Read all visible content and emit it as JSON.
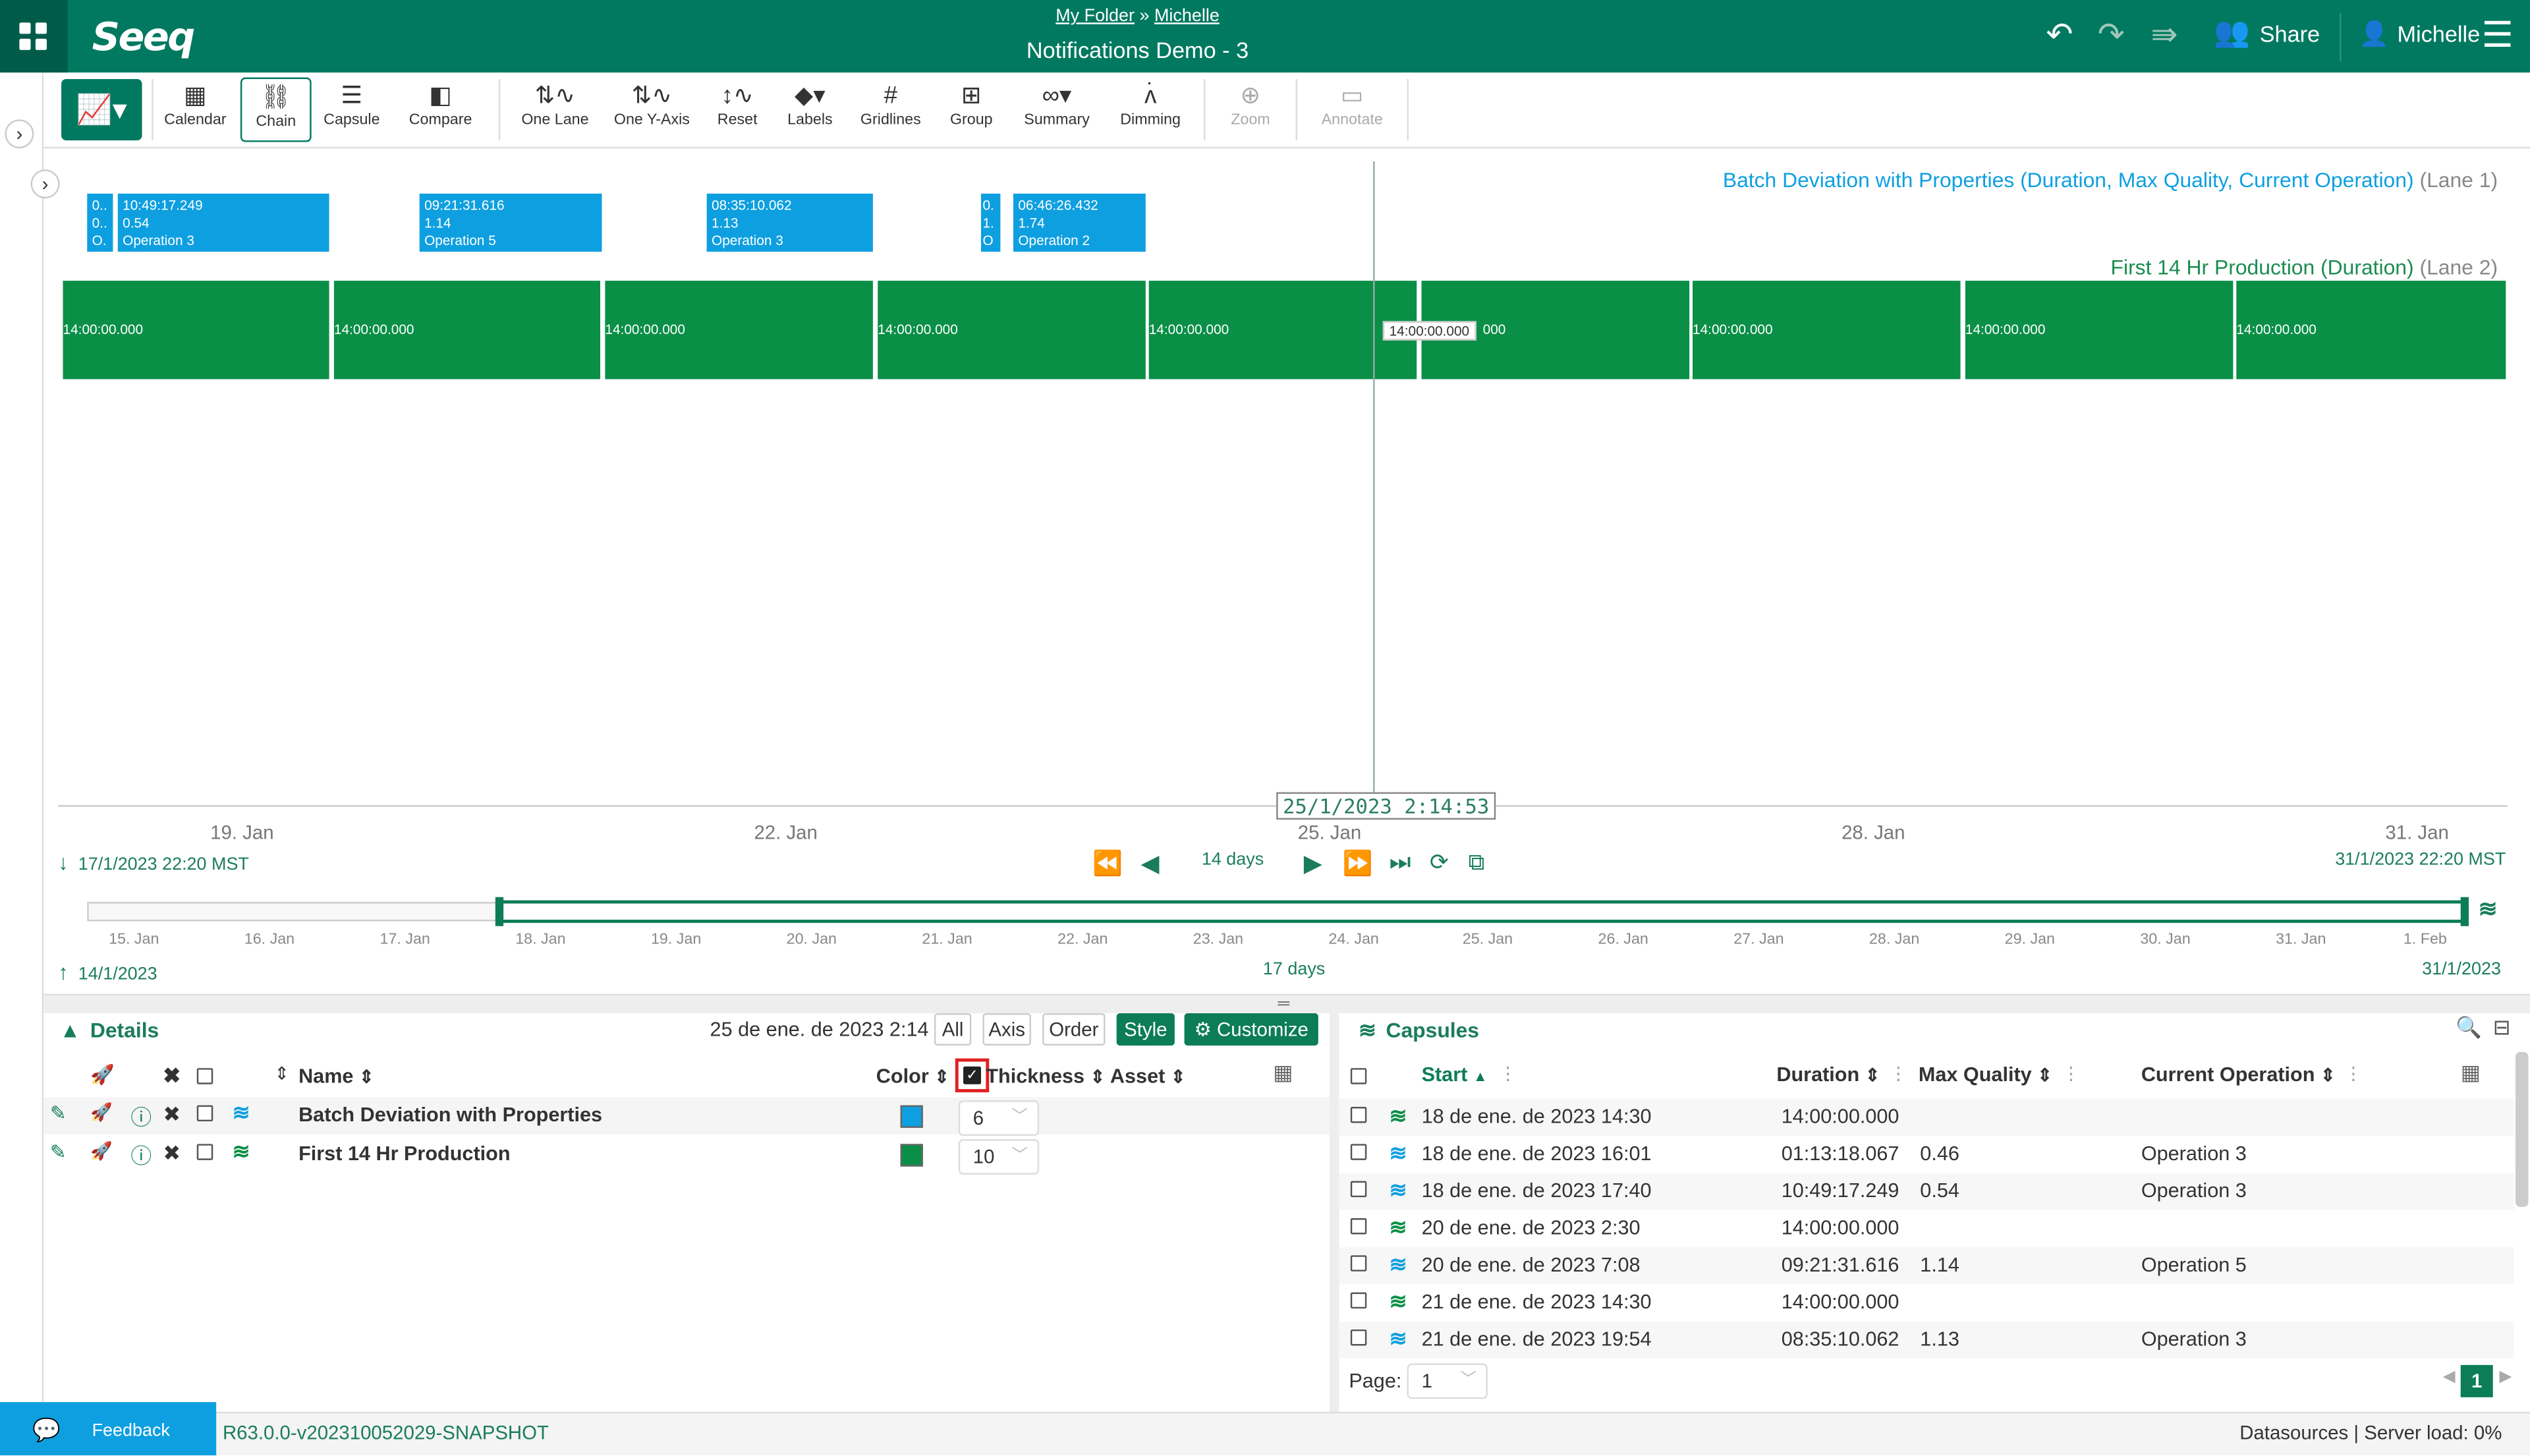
{
  "header": {
    "breadcrumb_folder": "My Folder",
    "breadcrumb_sep": "»",
    "breadcrumb_user": "Michelle",
    "title": "Notifications Demo - 3",
    "share_label": "Share",
    "user_label": "Michelle",
    "logo": "Seeq"
  },
  "toolbar": {
    "items": [
      {
        "label": "Calendar",
        "icon": "calendar-icon",
        "glyph": "▦"
      },
      {
        "label": "Chain",
        "icon": "chain-icon",
        "glyph": "⛓"
      },
      {
        "label": "Capsule",
        "icon": "capsule-icon",
        "glyph": "☰"
      },
      {
        "label": "Compare",
        "icon": "compare-icon",
        "glyph": "◧"
      },
      {
        "label": "One Lane",
        "icon": "one-lane-icon",
        "glyph": "⇅"
      },
      {
        "label": "One Y-Axis",
        "icon": "one-y-axis-icon",
        "glyph": "⇅"
      },
      {
        "label": "Reset",
        "icon": "reset-icon",
        "glyph": "↕"
      },
      {
        "label": "Labels",
        "icon": "labels-icon",
        "glyph": "🏷"
      },
      {
        "label": "Gridlines",
        "icon": "gridlines-icon",
        "glyph": "#"
      },
      {
        "label": "Group",
        "icon": "group-icon",
        "glyph": "⊞"
      },
      {
        "label": "Summary",
        "icon": "summary-icon",
        "glyph": "∿"
      },
      {
        "label": "Dimming",
        "icon": "dimming-icon",
        "glyph": "ʌ"
      },
      {
        "label": "Zoom",
        "icon": "zoom-icon",
        "glyph": "⊕"
      },
      {
        "label": "Annotate",
        "icon": "annotate-icon",
        "glyph": "💬"
      }
    ]
  },
  "chart": {
    "lane1_title": "Batch Deviation with Properties (Duration, Max Quality, ",
    "lane1_title_b": "Current Operation)",
    "lane1_suffix": "(Lane 1)",
    "lane2_title": "First 14 Hr Production (Duration)",
    "lane2_suffix": "(Lane 2)",
    "blue_capsules": [
      {
        "l1": "0..",
        "l2": "0..",
        "l3": "O."
      },
      {
        "l1": "10:49:17.249",
        "l2": "0.54",
        "l3": "Operation 3"
      },
      {
        "l1": "09:21:31.616",
        "l2": "1.14",
        "l3": "Operation 5"
      },
      {
        "l1": "08:35:10.062",
        "l2": "1.13",
        "l3": "Operation 3"
      },
      {
        "l1": "0.",
        "l2": "1.",
        "l3": "O"
      },
      {
        "l1": "06:46:26.432",
        "l2": "1.74",
        "l3": "Operation 2"
      }
    ],
    "green_capsules": [
      "14:00:00.000",
      "14:00:00.000",
      "14:00:00.000",
      "14:00:00.000",
      "14:00:00.000",
      "000",
      "14:00:00.000",
      "14:00:00.000",
      "14:00:00.000"
    ],
    "cursor_label": "14:00:00.000",
    "cursor_time": "25/1/2023 2:14:53",
    "x_ticks": [
      "19. Jan",
      "22. Jan",
      "25. Jan",
      "28. Jan",
      "31. Jan"
    ],
    "display_start": "17/1/2023 22:20  MST",
    "display_end": "31/1/2023 22:20  MST",
    "duration": "14 days",
    "nav_ticks": [
      "15. Jan",
      "16. Jan",
      "17. Jan",
      "18. Jan",
      "19. Jan",
      "20. Jan",
      "21. Jan",
      "22. Jan",
      "23. Jan",
      "24. Jan",
      "25. Jan",
      "26. Jan",
      "27. Jan",
      "28. Jan",
      "29. Jan",
      "30. Jan",
      "31. Jan",
      "1. Feb"
    ],
    "investigate_start": "14/1/2023",
    "investigate_end": "31/1/2023",
    "investigate_duration": "17 days"
  },
  "details": {
    "title": "Details",
    "timestamp": "25 de ene. de 2023 2:14",
    "buttons": {
      "all": "All",
      "axis": "Axis",
      "order": "Order",
      "style": "Style",
      "customize": "Customize"
    },
    "columns": {
      "name": "Name",
      "color": "Color",
      "thickness": "Thickness",
      "asset": "Asset"
    },
    "rows": [
      {
        "name": "Batch Deviation with Properties",
        "color": "#0e9fe0",
        "thickness": "6"
      },
      {
        "name": "First 14 Hr Production",
        "color": "#0a8f47",
        "thickness": "10"
      }
    ]
  },
  "capsules": {
    "title": "Capsules",
    "columns": {
      "start": "Start",
      "duration": "Duration",
      "max_quality": "Max Quality",
      "current_operation": "Current Operation"
    },
    "rows": [
      {
        "start": "18 de ene. de 2023 14:30",
        "duration": "14:00:00.000",
        "mq": "",
        "op": "",
        "color": "#0a8f47"
      },
      {
        "start": "18 de ene. de 2023 16:01",
        "duration": "01:13:18.067",
        "mq": "0.46",
        "op": "Operation 3",
        "color": "#0e9fe0"
      },
      {
        "start": "18 de ene. de 2023 17:40",
        "duration": "10:49:17.249",
        "mq": "0.54",
        "op": "Operation 3",
        "color": "#0e9fe0"
      },
      {
        "start": "20 de ene. de 2023 2:30",
        "duration": "14:00:00.000",
        "mq": "",
        "op": "",
        "color": "#0a8f47"
      },
      {
        "start": "20 de ene. de 2023 7:08",
        "duration": "09:21:31.616",
        "mq": "1.14",
        "op": "Operation 5",
        "color": "#0e9fe0"
      },
      {
        "start": "21 de ene. de 2023 14:30",
        "duration": "14:00:00.000",
        "mq": "",
        "op": "",
        "color": "#0a8f47"
      },
      {
        "start": "21 de ene. de 2023 19:54",
        "duration": "08:35:10.062",
        "mq": "1.13",
        "op": "Operation 3",
        "color": "#0e9fe0"
      }
    ],
    "page_label": "Page:",
    "page_value": "1",
    "current_page": "1"
  },
  "footer": {
    "feedback": "Feedback",
    "version": "R63.0.0-v202310052029-SNAPSHOT",
    "datasources": "Datasources",
    "sep": "|",
    "server_load": "Server load:",
    "server_load_value": "0%"
  }
}
